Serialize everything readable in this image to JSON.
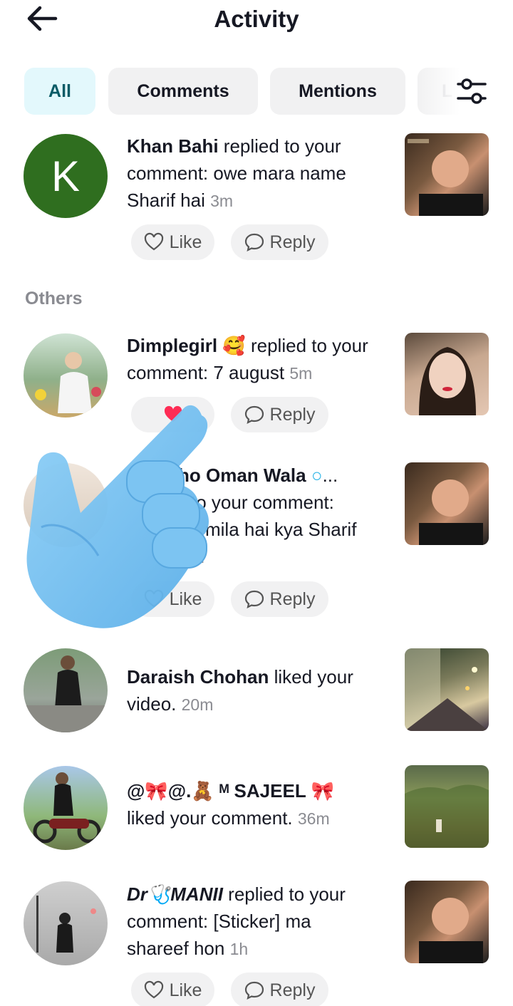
{
  "header": {
    "title": "Activity"
  },
  "tabs": [
    {
      "label": "All",
      "active": true
    },
    {
      "label": "Comments",
      "active": false
    },
    {
      "label": "Mentions",
      "active": false
    },
    {
      "label": "L",
      "active": false
    }
  ],
  "sections": {
    "others_label": "Others"
  },
  "notifications": [
    {
      "user": "Khan Bahi",
      "action_line1": " replied to your",
      "action_line2": "comment: owe mara name",
      "action_line3": "Sharif hai",
      "time": "3m",
      "like_label": "Like",
      "reply_label": "Reply",
      "avatar_letter": "K"
    },
    {
      "user": "Dimplegirl",
      "emoji": "🥰",
      "action_line1": " replied to your",
      "action_line2": "comment: 7 august",
      "time": "5m",
      "reply_label": "Reply"
    },
    {
      "user_partial": "ho Oman Wala",
      "badge": "○",
      "ellipsis": "...",
      "action_line1": "to your comment:",
      "action_line2": "mila hai kya Sharif",
      "time_partial": "n",
      "like_label": "Like",
      "reply_label": "Reply"
    },
    {
      "user": "Daraish Chohan",
      "action_line1": " liked your",
      "action_line2": "video.",
      "time": "20m"
    },
    {
      "user": "@🎀@.🧸 ᴹ SAJEEL 🎀",
      "action_line1": "liked your comment.",
      "time": "36m"
    },
    {
      "user": "Dr🩺MANII",
      "action_line1": " replied to your",
      "action_line2": "comment: [Sticker] ma",
      "action_line3": "shareef hon",
      "time": "1h",
      "like_label": "Like",
      "reply_label": "Reply"
    }
  ],
  "icons": {
    "back": "arrow-left-icon",
    "filter": "sliders-icon",
    "like": "heart-outline-icon",
    "liked": "heart-filled-icon",
    "reply": "speech-bubble-icon",
    "overlay": "pointing-hand-icon"
  },
  "colors": {
    "active_tab_bg": "#e3f8fc",
    "active_tab_text": "#0a5b66",
    "avatar_k": "#2f6e1f",
    "heart": "#fe2c55",
    "hand": "#7cc4f2"
  }
}
